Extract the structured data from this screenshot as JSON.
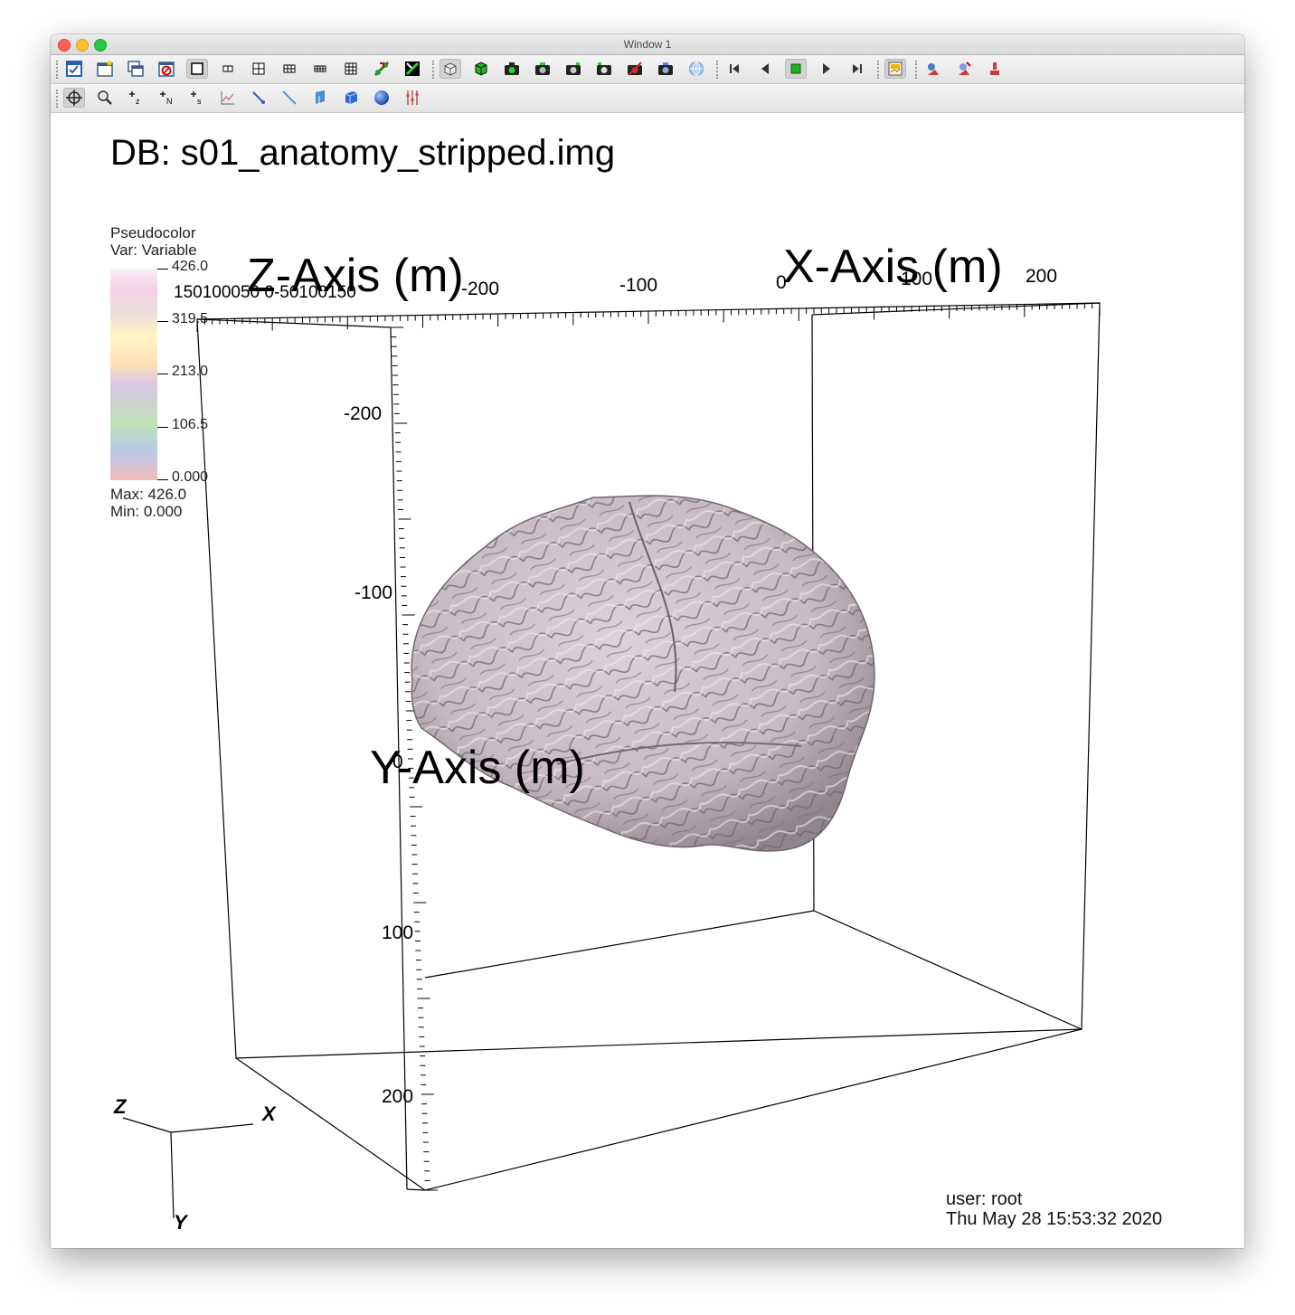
{
  "window": {
    "title": "Window 1"
  },
  "toolbar_top": {
    "buttons": [
      "active-window-icon",
      "new-window-icon",
      "clone-window-icon",
      "delete-window-icon",
      "layout-1x1-icon",
      "layout-1x2-icon",
      "layout-2x2-icon",
      "layout-2x3-icon",
      "layout-2x4-icon",
      "layout-3x3-icon",
      "lock-view-icon",
      "lock-time-icon",
      "toggle-3d-mode-icon",
      "spin-icon",
      "camera-1-icon",
      "camera-2-icon",
      "camera-3-icon",
      "camera-4-icon",
      "camera-5-icon",
      "navigate-mode-icon",
      "rewind-icon",
      "reverse-step-icon",
      "stop-icon",
      "play-icon",
      "forward-step-icon",
      "save-window-icon",
      "invert-background-icon",
      "reset-view-icon",
      "recenter-icon"
    ]
  },
  "toolbar_bottom": {
    "buttons": [
      "navigate-icon",
      "zoom-icon",
      "zone-pick-icon",
      "node-pick-icon",
      "spreadsheet-pick-icon",
      "lineout-icon",
      "point-tool-icon",
      "line-tool-icon",
      "plane-tool-icon",
      "box-tool-icon",
      "sphere-tool-icon",
      "axis-restrict-icon"
    ]
  },
  "viewport": {
    "db_title": "DB: s01_anatomy_stripped.img",
    "legend": {
      "title_line1": "Pseudocolor",
      "title_line2": "Var: Variable",
      "labels": [
        "426.0",
        "319.5",
        "213.0",
        "106.5",
        "0.000"
      ],
      "max_label": "Max:  426.0",
      "min_label": "Min:  0.000",
      "overlap_text": "150100050  0-50100150"
    },
    "axes": {
      "z_title": "Z-Axis (m)",
      "x_title": "X-Axis (m)",
      "y_title": "Y-Axis (m)",
      "x_ticks": [
        "-200",
        "-100",
        "0",
        "100",
        "200"
      ],
      "y_ticks": [
        "-200",
        "-100",
        "0",
        "100",
        "200"
      ]
    },
    "triad": {
      "z": "Z",
      "x": "X",
      "y": "Y"
    },
    "user": "user: root",
    "timestamp": "Thu May 28 15:53:32 2020"
  },
  "colors": {
    "surface": "#cfc4cb",
    "surface_shadow": "#8f858c",
    "background": "#ffffff"
  }
}
